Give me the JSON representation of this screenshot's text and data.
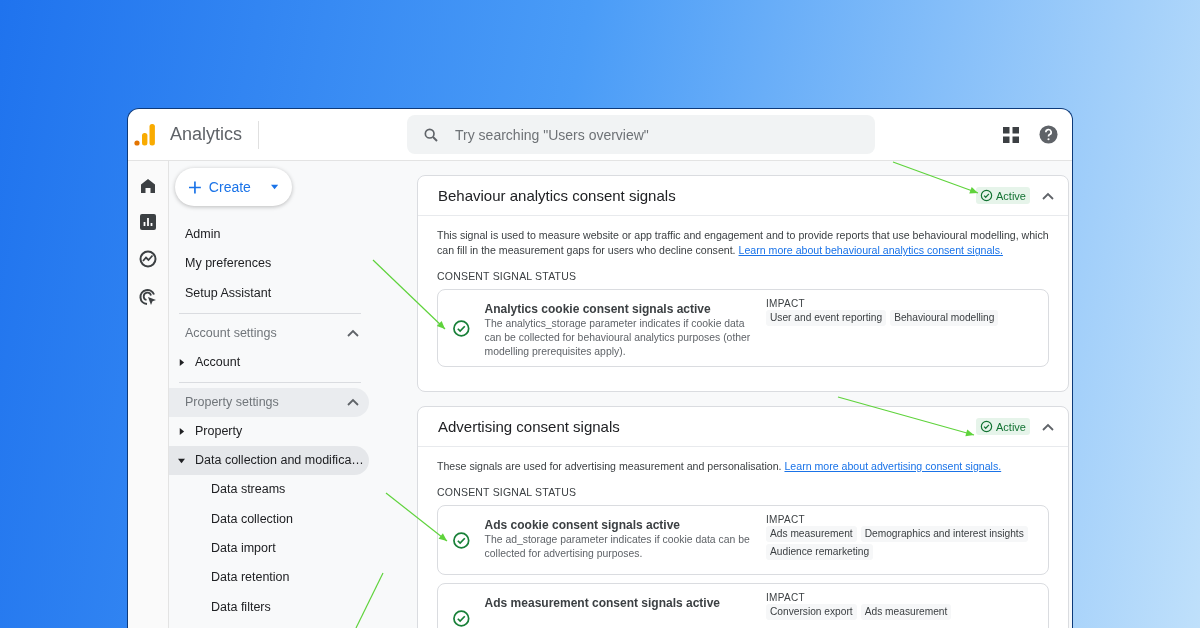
{
  "app": {
    "name": "Analytics"
  },
  "search": {
    "placeholder": "Try searching \"Users overview\""
  },
  "create_button": {
    "label": "Create"
  },
  "sidebar": {
    "top_items": [
      "Admin",
      "My preferences",
      "Setup Assistant"
    ],
    "sections": [
      {
        "title": "Account settings",
        "expanded": true,
        "highlighted": false,
        "items": [
          {
            "label": "Account",
            "expanded": false,
            "selected": false
          }
        ]
      },
      {
        "title": "Property settings",
        "expanded": true,
        "highlighted": true,
        "items": [
          {
            "label": "Property",
            "expanded": false,
            "selected": false
          },
          {
            "label": "Data collection and modifica…",
            "expanded": true,
            "selected": true,
            "children": [
              {
                "label": "Data streams"
              },
              {
                "label": "Data collection"
              },
              {
                "label": "Data import"
              },
              {
                "label": "Data retention"
              },
              {
                "label": "Data filters"
              }
            ]
          }
        ]
      }
    ]
  },
  "cards": [
    {
      "title": "Behaviour analytics consent signals",
      "status": "Active",
      "expanded": true,
      "description": "This signal is used to measure website or app traffic and engagement and to provide reports that use behavioural modelling, which can fill in the measurement gaps for users who decline consent.",
      "link": "Learn more about behavioural analytics consent signals.",
      "status_heading": "CONSENT SIGNAL STATUS",
      "signals": [
        {
          "title": "Analytics cookie consent signals active",
          "description": "The analytics_storage parameter indicates if cookie data can be collected for behavioural analytics purposes (other modelling prerequisites apply).",
          "active": true,
          "impact_label": "IMPACT",
          "impacts": [
            "User and event reporting",
            "Behavioural modelling"
          ]
        }
      ]
    },
    {
      "title": "Advertising consent signals",
      "status": "Active",
      "expanded": true,
      "description": "These signals are used for advertising measurement and personalisation.",
      "link": "Learn more about advertising consent signals.",
      "status_heading": "CONSENT SIGNAL STATUS",
      "signals": [
        {
          "title": "Ads cookie consent signals active",
          "description": "The ad_storage parameter indicates if cookie data can be collected for advertising purposes.",
          "active": true,
          "impact_label": "IMPACT",
          "impacts": [
            "Ads measurement",
            "Demographics and interest insights",
            "Audience remarketing"
          ]
        },
        {
          "title": "Ads measurement consent signals active",
          "active": true,
          "impact_label": "IMPACT",
          "impacts": [
            "Conversion export",
            "Ads measurement"
          ]
        }
      ]
    }
  ]
}
